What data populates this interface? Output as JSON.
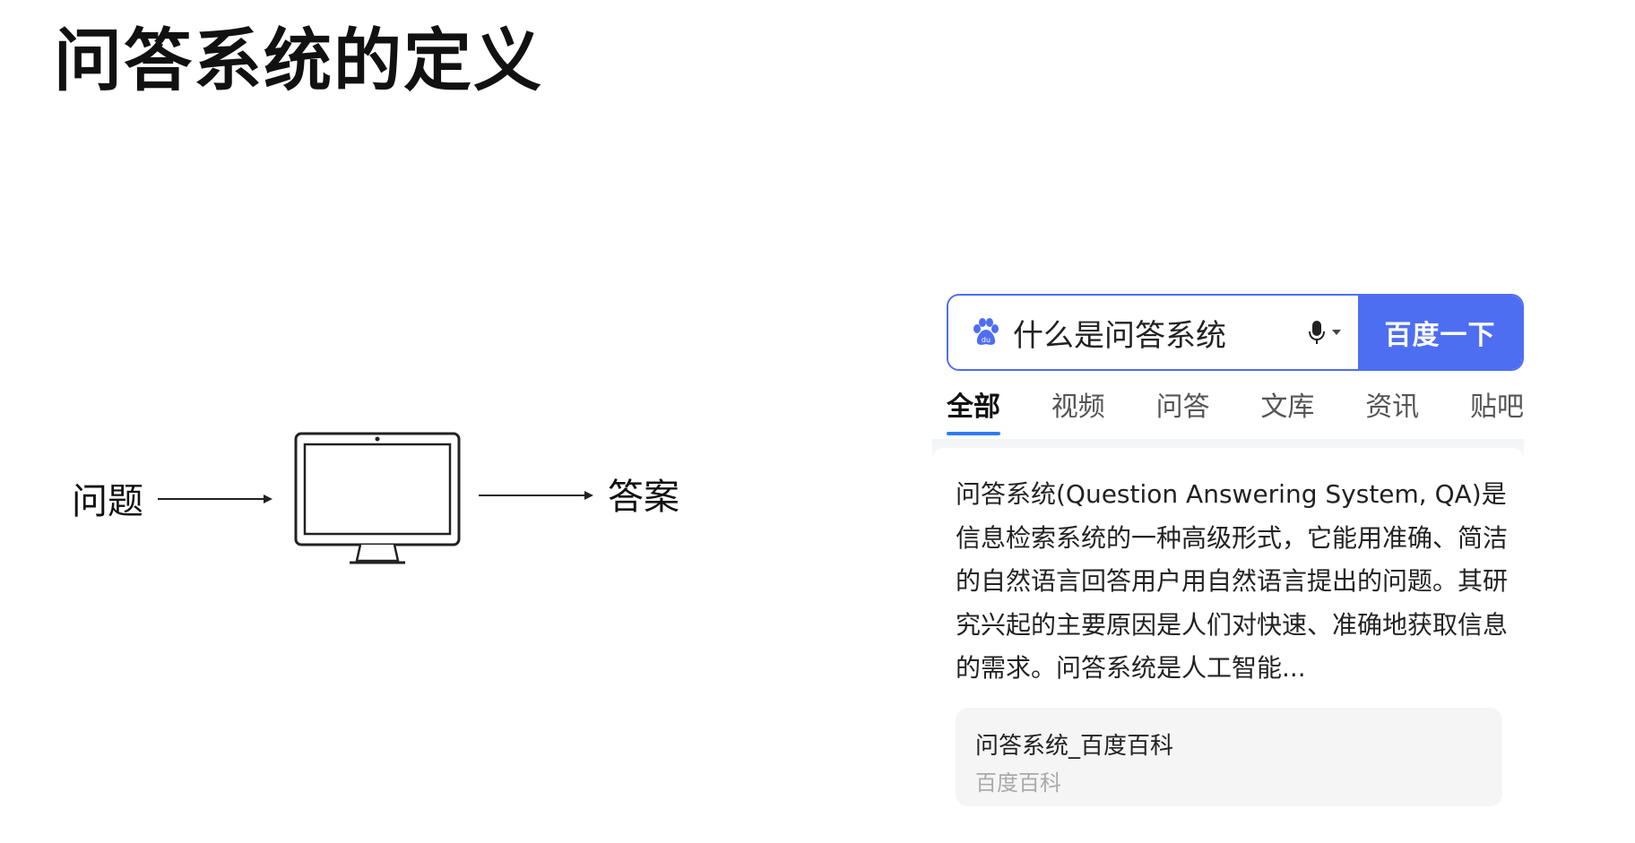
{
  "slide": {
    "title": "问答系统的定义"
  },
  "diagram": {
    "question_label": "问题",
    "answer_label": "答案",
    "computer_icon": "monitor-icon"
  },
  "search": {
    "query": "什么是问答系统",
    "button_label": "百度一下",
    "logo_icon": "baidu-paw-icon",
    "voice_icon": "microphone-icon",
    "accent_color": "#4e6ef2",
    "tabs": [
      {
        "label": "全部",
        "active": true
      },
      {
        "label": "视频",
        "active": false
      },
      {
        "label": "问答",
        "active": false
      },
      {
        "label": "文库",
        "active": false
      },
      {
        "label": "资讯",
        "active": false
      },
      {
        "label": "贴吧",
        "active": false
      }
    ],
    "result": {
      "snippet": "问答系统(Question Answering System, QA)是信息检索系统的一种高级形式，它能用准确、简洁的自然语言回答用户用自然语言提出的问题。其研究兴起的主要原因是人们对快速、准确地获取信息的需求。问答系统是人工智能...",
      "source_title": "问答系统_百度百科",
      "source_site": "百度百科"
    }
  }
}
